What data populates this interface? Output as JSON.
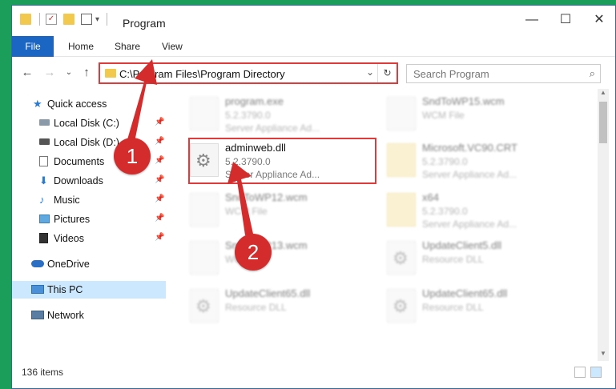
{
  "window": {
    "title": "Program",
    "minimize_glyph": "—",
    "maximize_glyph": "☐",
    "close_glyph": "✕"
  },
  "ribbon": {
    "tabs": [
      "File",
      "Home",
      "Share",
      "View"
    ]
  },
  "address": {
    "path": "C:\\Program Files\\Program Directory",
    "dropdown_glyph": "⌄",
    "refresh_glyph": "↻"
  },
  "search": {
    "placeholder": "Search Program"
  },
  "navigation": {
    "items": [
      {
        "label": "Quick access",
        "icon": "star-icon"
      },
      {
        "label": "Local Disk (C:)",
        "icon": "drive-icon"
      },
      {
        "label": "Local Disk (D:)",
        "icon": "drive-icon"
      },
      {
        "label": "Documents",
        "icon": "document-icon"
      },
      {
        "label": "Downloads",
        "icon": "download-icon"
      },
      {
        "label": "Music",
        "icon": "music-icon"
      },
      {
        "label": "Pictures",
        "icon": "pictures-icon"
      },
      {
        "label": "Videos",
        "icon": "video-icon"
      },
      {
        "label": "OneDrive",
        "icon": "cloud-icon"
      },
      {
        "label": "This PC",
        "icon": "computer-icon"
      },
      {
        "label": "Network",
        "icon": "network-icon"
      }
    ]
  },
  "files": [
    {
      "name": "program.exe",
      "line2": "5.2.3790.0",
      "line3": "Server Appliance Ad...",
      "icon": "exe-icon"
    },
    {
      "name": "SndToWP15.wcm",
      "line2": "WCM File",
      "line3": "",
      "icon": "file-icon"
    },
    {
      "name": "adminweb.dll",
      "line2": "5.2.3790.0",
      "line3": "Server Appliance Ad...",
      "icon": "dll-gear-icon"
    },
    {
      "name": "Microsoft.VC90.CRT",
      "line2": "5.2.3790.0",
      "line3": "Server Appliance Ad...",
      "icon": "folder-icon"
    },
    {
      "name": "SndToWP12.wcm",
      "line2": "WCM File",
      "line3": "",
      "icon": "file-icon"
    },
    {
      "name": "x64",
      "line2": "5.2.3790.0",
      "line3": "Server Appliance Ad...",
      "icon": "folder-icon"
    },
    {
      "name": "SndToWP13.wcm",
      "line2": "WCM File",
      "line3": "",
      "icon": "file-icon"
    },
    {
      "name": "UpdateClient5.dll",
      "line2": "Resource DLL",
      "line3": "",
      "icon": "dll-gear-icon"
    },
    {
      "name": "UpdateClient65.dll",
      "line2": "Resource DLL",
      "line3": "",
      "icon": "dll-gear-icon"
    },
    {
      "name": "UpdateClient65.dll",
      "line2": "Resource DLL",
      "line3": "",
      "icon": "dll-gear-icon"
    }
  ],
  "status": {
    "item_count": "136 items"
  },
  "annotations": {
    "step1": "1",
    "step2": "2",
    "color": "#d42c2c"
  }
}
